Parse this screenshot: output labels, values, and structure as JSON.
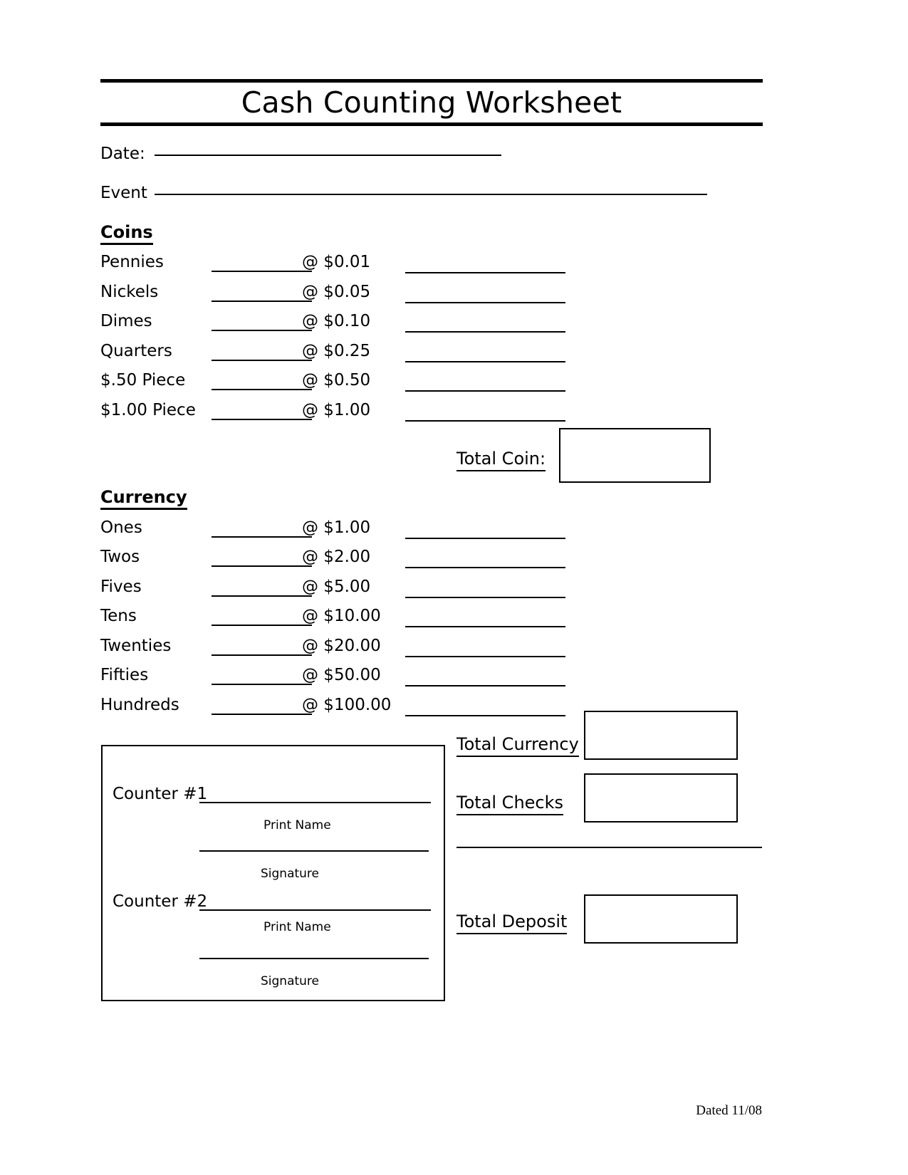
{
  "document": {
    "title": "Cash Counting Worksheet",
    "footer_note": "Dated 11/08"
  },
  "header_fields": {
    "date_label": "Date:",
    "event_label": "Event"
  },
  "coins": {
    "heading": "Coins",
    "rows": [
      {
        "name": "Pennies",
        "rate": "@ $0.01"
      },
      {
        "name": "Nickels",
        "rate": "@ $0.05"
      },
      {
        "name": "Dimes",
        "rate": "@ $0.10"
      },
      {
        "name": "Quarters",
        "rate": "@ $0.25"
      },
      {
        "name": "$.50 Piece",
        "rate": "@ $0.50"
      },
      {
        "name": "$1.00 Piece",
        "rate": "@ $1.00"
      }
    ],
    "total_label": "Total Coin:"
  },
  "currency": {
    "heading": "Currency",
    "rows": [
      {
        "name": "Ones",
        "rate": "@ $1.00"
      },
      {
        "name": "Twos",
        "rate": "@ $2.00"
      },
      {
        "name": "Fives",
        "rate": "@ $5.00"
      },
      {
        "name": "Tens",
        "rate": "@ $10.00"
      },
      {
        "name": "Twenties",
        "rate": "@ $20.00"
      },
      {
        "name": "Fifties",
        "rate": "@ $50.00"
      },
      {
        "name": "Hundreds",
        "rate": "@ $100.00"
      }
    ],
    "total_label": "Total Currency"
  },
  "totals": {
    "checks_label": "Total Checks",
    "deposit_label": "Total Deposit"
  },
  "counters": [
    {
      "label": "Counter #1",
      "print_name_caption": "Print Name",
      "signature_caption": "Signature"
    },
    {
      "label": "Counter #2",
      "print_name_caption": "Print Name",
      "signature_caption": "Signature"
    }
  ],
  "colors": {
    "ink": "#000000",
    "paper": "#ffffff"
  }
}
